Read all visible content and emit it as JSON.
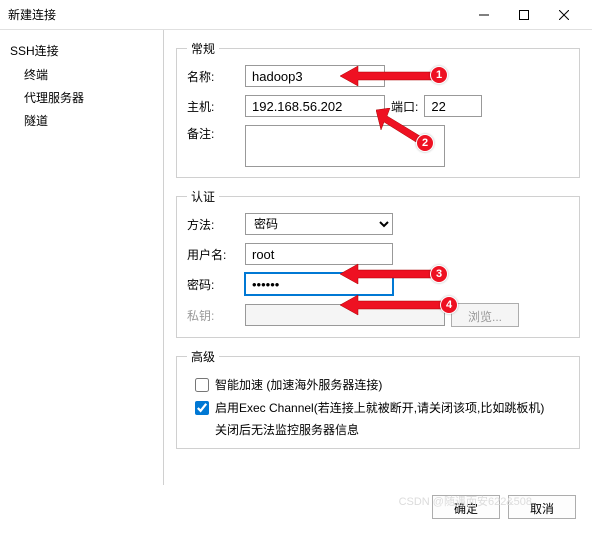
{
  "titlebar": {
    "title": "新建连接"
  },
  "sidebar": {
    "header": "SSH连接",
    "items": [
      {
        "label": "终端"
      },
      {
        "label": "代理服务器"
      },
      {
        "label": "隧道"
      }
    ]
  },
  "general": {
    "legend": "常规",
    "name_label": "名称:",
    "name_value": "hadoop3",
    "host_label": "主机:",
    "host_value": "192.168.56.202",
    "port_label": "端口:",
    "port_value": "22",
    "notes_label": "备注:",
    "notes_value": ""
  },
  "auth": {
    "legend": "认证",
    "method_label": "方法:",
    "method_value": "密码",
    "user_label": "用户名:",
    "user_value": "root",
    "pass_label": "密码:",
    "pass_value": "••••••",
    "key_label": "私钥:",
    "key_value": "",
    "browse_label": "浏览..."
  },
  "advanced": {
    "legend": "高级",
    "accel_label": "智能加速 (加速海外服务器连接)",
    "exec_label": "启用Exec Channel(若连接上就被断开,请关闭该项,比如跳板机)",
    "exec_note": "关闭后无法监控服务器信息"
  },
  "footer": {
    "ok": "确定",
    "cancel": "取消"
  },
  "watermark": "CSDN @随遇而安622&508",
  "annotations": {
    "b1": "1",
    "b2": "2",
    "b3": "3",
    "b4": "4"
  }
}
